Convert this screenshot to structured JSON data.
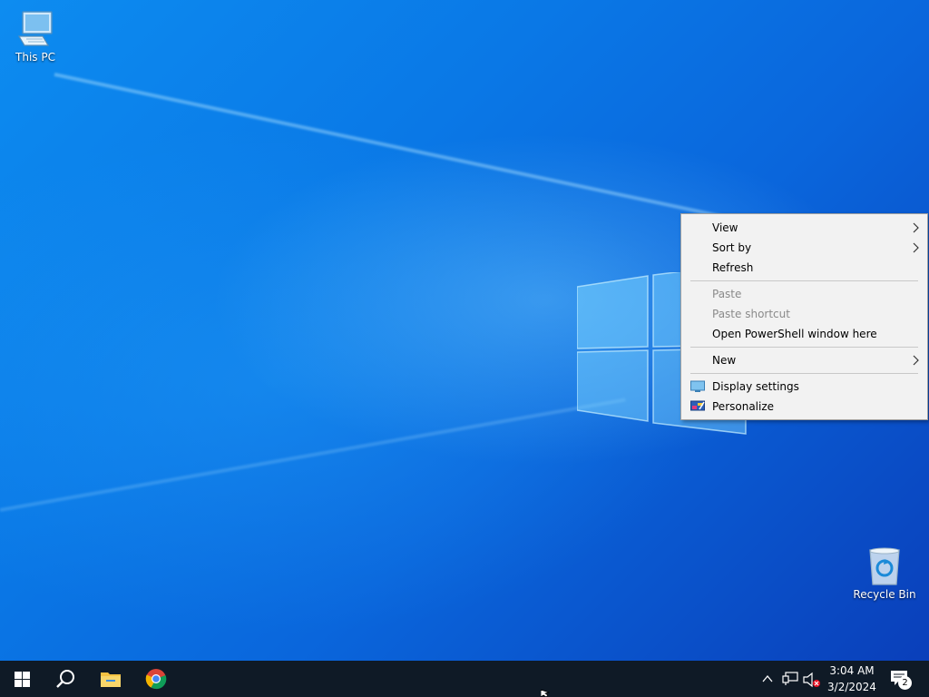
{
  "desktop_icons": [
    {
      "label": "This PC",
      "icon": "this-pc-icon"
    },
    {
      "label": "Recycle Bin",
      "icon": "recycle-bin-icon"
    }
  ],
  "context_menu": {
    "items": [
      {
        "label": "View",
        "submenu": true
      },
      {
        "label": "Sort by",
        "submenu": true
      },
      {
        "label": "Refresh"
      },
      {
        "label": "Paste",
        "disabled": true
      },
      {
        "label": "Paste shortcut",
        "disabled": true
      },
      {
        "label": "Open PowerShell window here"
      },
      {
        "label": "New",
        "submenu": true
      },
      {
        "label": "Display settings",
        "icon": "display-settings-icon"
      },
      {
        "label": "Personalize",
        "icon": "personalize-icon"
      }
    ]
  },
  "taskbar": {
    "pinned": [
      "start-icon",
      "search-icon",
      "file-explorer-icon",
      "chrome-icon"
    ],
    "tray_icons": [
      "chevron-up-icon",
      "network-icon",
      "volume-muted-icon"
    ],
    "clock": {
      "time": "3:04 AM",
      "date": "3/2/2024"
    },
    "notifications": {
      "count": "2"
    }
  },
  "colors": {
    "taskbar": "#0f1a26",
    "menu_bg": "#f2f2f2",
    "desktop_accent": "#0a78e6"
  }
}
